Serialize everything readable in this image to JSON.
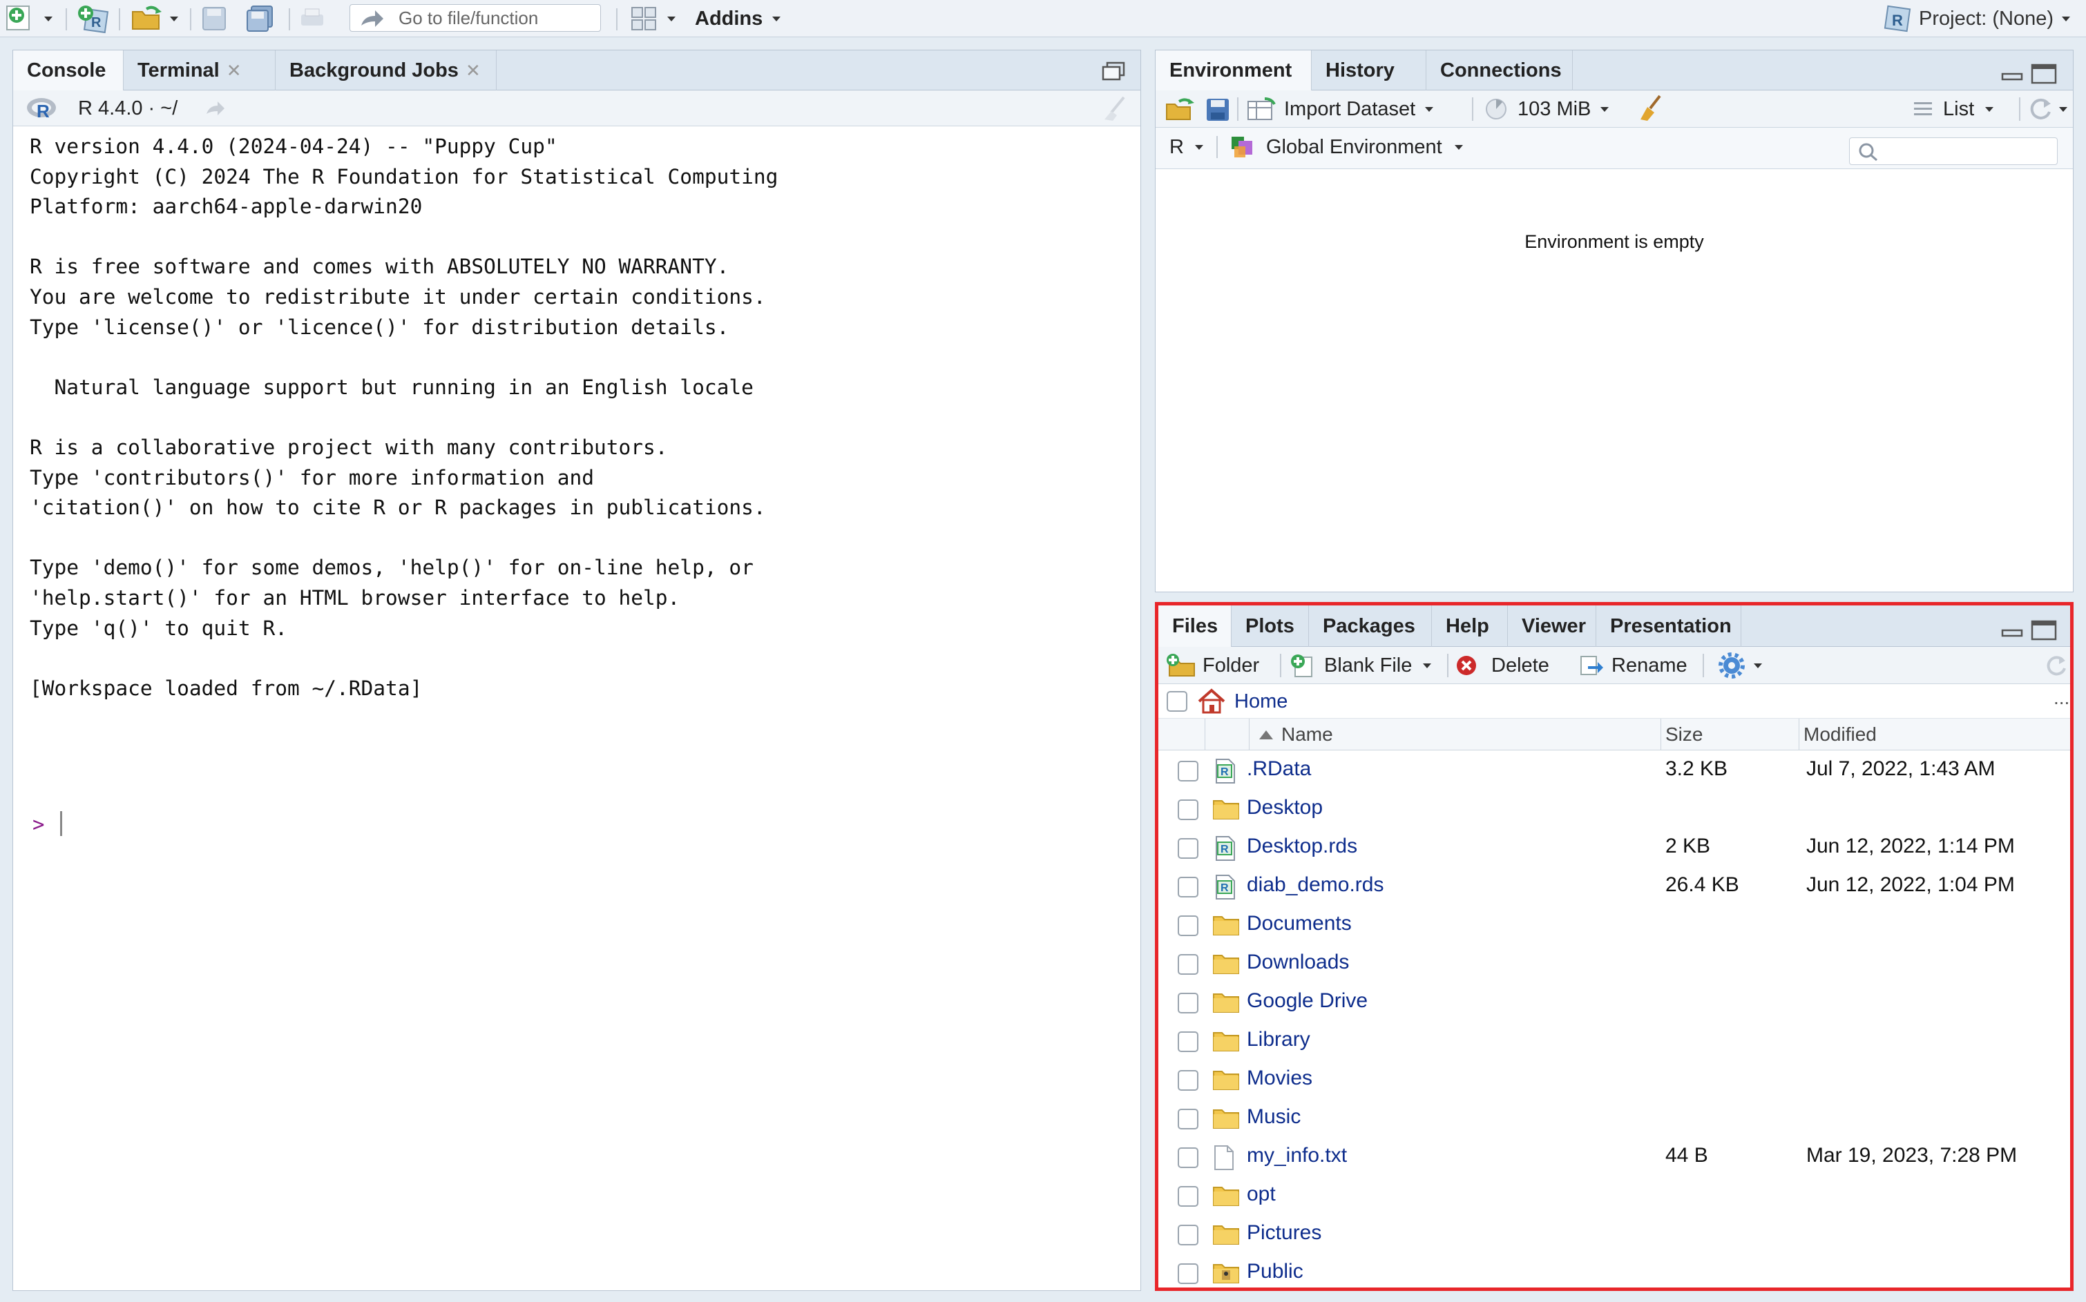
{
  "toolbar": {
    "goto_placeholder": "Go to file/function",
    "addins_label": "Addins",
    "project_label": "Project: (None)",
    "icons": [
      "new-file-icon",
      "new-project-icon",
      "open-folder-icon",
      "save-icon",
      "save-all-icon",
      "print-icon",
      "arrow-icon",
      "grid-layout-icon",
      "r-project-icon"
    ]
  },
  "console_pane": {
    "tabs": [
      {
        "label": "Console",
        "closable": false
      },
      {
        "label": "Terminal",
        "closable": true
      },
      {
        "label": "Background Jobs",
        "closable": true
      }
    ],
    "r_version_label": "R 4.4.0 · ~/",
    "lines": [
      "R version 4.4.0 (2024-04-24) -- \"Puppy Cup\"",
      "Copyright (C) 2024 The R Foundation for Statistical Computing",
      "Platform: aarch64-apple-darwin20",
      "",
      "R is free software and comes with ABSOLUTELY NO WARRANTY.",
      "You are welcome to redistribute it under certain conditions.",
      "Type 'license()' or 'licence()' for distribution details.",
      "",
      "  Natural language support but running in an English locale",
      "",
      "R is a collaborative project with many contributors.",
      "Type 'contributors()' for more information and",
      "'citation()' on how to cite R or R packages in publications.",
      "",
      "Type 'demo()' for some demos, 'help()' for on-line help, or",
      "'help.start()' for an HTML browser interface to help.",
      "Type 'q()' to quit R.",
      "",
      "[Workspace loaded from ~/.RData]"
    ],
    "prompt": ">"
  },
  "env_pane": {
    "tabs": [
      {
        "label": "Environment"
      },
      {
        "label": "History"
      },
      {
        "label": "Connections"
      }
    ],
    "import_dataset_label": "Import Dataset",
    "memory_label": "103 MiB",
    "view_mode_label": "List",
    "language_label": "R",
    "scope_label": "Global Environment",
    "search_placeholder": "",
    "empty_message": "Environment is empty"
  },
  "files_pane": {
    "tabs": [
      {
        "label": "Files"
      },
      {
        "label": "Plots"
      },
      {
        "label": "Packages"
      },
      {
        "label": "Help"
      },
      {
        "label": "Viewer"
      },
      {
        "label": "Presentation"
      }
    ],
    "new_folder_label": "Folder",
    "blank_file_label": "Blank File",
    "delete_label": "Delete",
    "rename_label": "Rename",
    "path_label": "Home",
    "more_label": "...",
    "columns": {
      "name": "Name",
      "size": "Size",
      "modified": "Modified"
    },
    "highlight_color": "#e8262a",
    "files": [
      {
        "name": ".RData",
        "type": "r-data",
        "size": "3.2 KB",
        "modified": "Jul 7, 2022, 1:43 AM"
      },
      {
        "name": "Desktop",
        "type": "folder",
        "size": "",
        "modified": ""
      },
      {
        "name": "Desktop.rds",
        "type": "r-data",
        "size": "2 KB",
        "modified": "Jun 12, 2022, 1:14 PM"
      },
      {
        "name": "diab_demo.rds",
        "type": "r-data",
        "size": "26.4 KB",
        "modified": "Jun 12, 2022, 1:04 PM"
      },
      {
        "name": "Documents",
        "type": "folder",
        "size": "",
        "modified": ""
      },
      {
        "name": "Downloads",
        "type": "folder",
        "size": "",
        "modified": ""
      },
      {
        "name": "Google Drive",
        "type": "folder",
        "size": "",
        "modified": ""
      },
      {
        "name": "Library",
        "type": "folder",
        "size": "",
        "modified": ""
      },
      {
        "name": "Movies",
        "type": "folder",
        "size": "",
        "modified": ""
      },
      {
        "name": "Music",
        "type": "folder",
        "size": "",
        "modified": ""
      },
      {
        "name": "my_info.txt",
        "type": "text",
        "size": "44 B",
        "modified": "Mar 19, 2023, 7:28 PM"
      },
      {
        "name": "opt",
        "type": "folder",
        "size": "",
        "modified": ""
      },
      {
        "name": "Pictures",
        "type": "folder",
        "size": "",
        "modified": ""
      },
      {
        "name": "Public",
        "type": "folder-public",
        "size": "",
        "modified": ""
      }
    ]
  }
}
